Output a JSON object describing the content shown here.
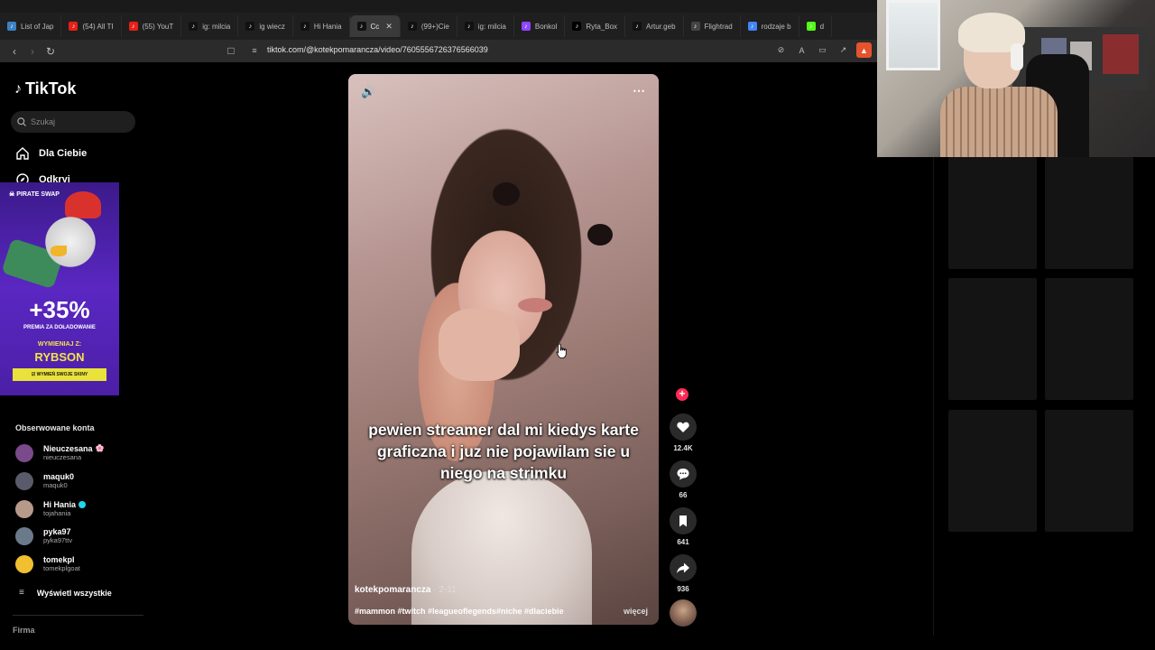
{
  "browser": {
    "tabs": [
      {
        "label": "List of Jap",
        "fav_color": "#3b82c4"
      },
      {
        "label": "(54) All TI",
        "fav_color": "#e62117"
      },
      {
        "label": "(55) YouT",
        "fav_color": "#e62117"
      },
      {
        "label": "ig: milcia",
        "fav_color": "#111111"
      },
      {
        "label": "ig wiecz",
        "fav_color": "#111111"
      },
      {
        "label": "Hi Hania",
        "fav_color": "#111111"
      },
      {
        "label": "Cc",
        "fav_color": "#111111",
        "active": true
      },
      {
        "label": "(99+)Cie",
        "fav_color": "#111111"
      },
      {
        "label": "ig: milcia",
        "fav_color": "#111111"
      },
      {
        "label": "Bonkol",
        "fav_color": "#9146ff"
      },
      {
        "label": "Ryta_Box",
        "fav_color": "#000000"
      },
      {
        "label": "Artur.geb",
        "fav_color": "#111111"
      },
      {
        "label": "Flightrad",
        "fav_color": "#444444"
      },
      {
        "label": "rodzaje b",
        "fav_color": "#4285f4"
      },
      {
        "label": "d",
        "fav_color": "#53fc18"
      }
    ],
    "url": "tiktok.com/@kotekpomarancza/video/7605556726376566039"
  },
  "sidebar": {
    "logo": "TikTok",
    "search_placeholder": "Szukaj",
    "nav": [
      {
        "label": "Dla Ciebie",
        "icon": "home-icon"
      },
      {
        "label": "Odkryj",
        "icon": "compass-icon"
      }
    ],
    "ad": {
      "brand": "PIRATE SWAP",
      "percent": "+35%",
      "premia": "PREMIA ZA DOŁADOWANIE",
      "wymieniaj": "WYMIENIAJ Z:",
      "code": "RYBSON",
      "cta": "WYMIEŃ SWOJE SKINY"
    },
    "following_title": "Obserwowane konta",
    "following": [
      {
        "name": "Nieuczesana",
        "username": "nieuczesana",
        "badge": "🌸",
        "avatar_color": "#7a4a8a"
      },
      {
        "name": "maquk0",
        "username": "maquk0",
        "badge": "",
        "avatar_color": "#5a5a6a"
      },
      {
        "name": "Hi Hania",
        "username": "tojahania",
        "badge": "verified",
        "avatar_color": "#b89a8a"
      },
      {
        "name": "pyka97",
        "username": "pyka97ttv",
        "badge": "",
        "avatar_color": "#6a7a8a"
      },
      {
        "name": "tomekpl",
        "username": "tomekplgoat",
        "badge": "",
        "avatar_color": "#f0c030"
      }
    ],
    "show_all": "Wyświetl wszystkie",
    "footer": "Firma"
  },
  "video": {
    "caption": "pewien streamer dal mi kiedys karte graficzna i juz nie pojawilam sie u niego na strimku",
    "author": "kotekpomarancza",
    "date": "· 2-11",
    "hashtags": "#mammon #twitch #leagueoflegends#niche #dlaciebie",
    "more": "więcej"
  },
  "actions": {
    "likes": "12.4K",
    "comments": "66",
    "saves": "641",
    "shares": "936"
  }
}
